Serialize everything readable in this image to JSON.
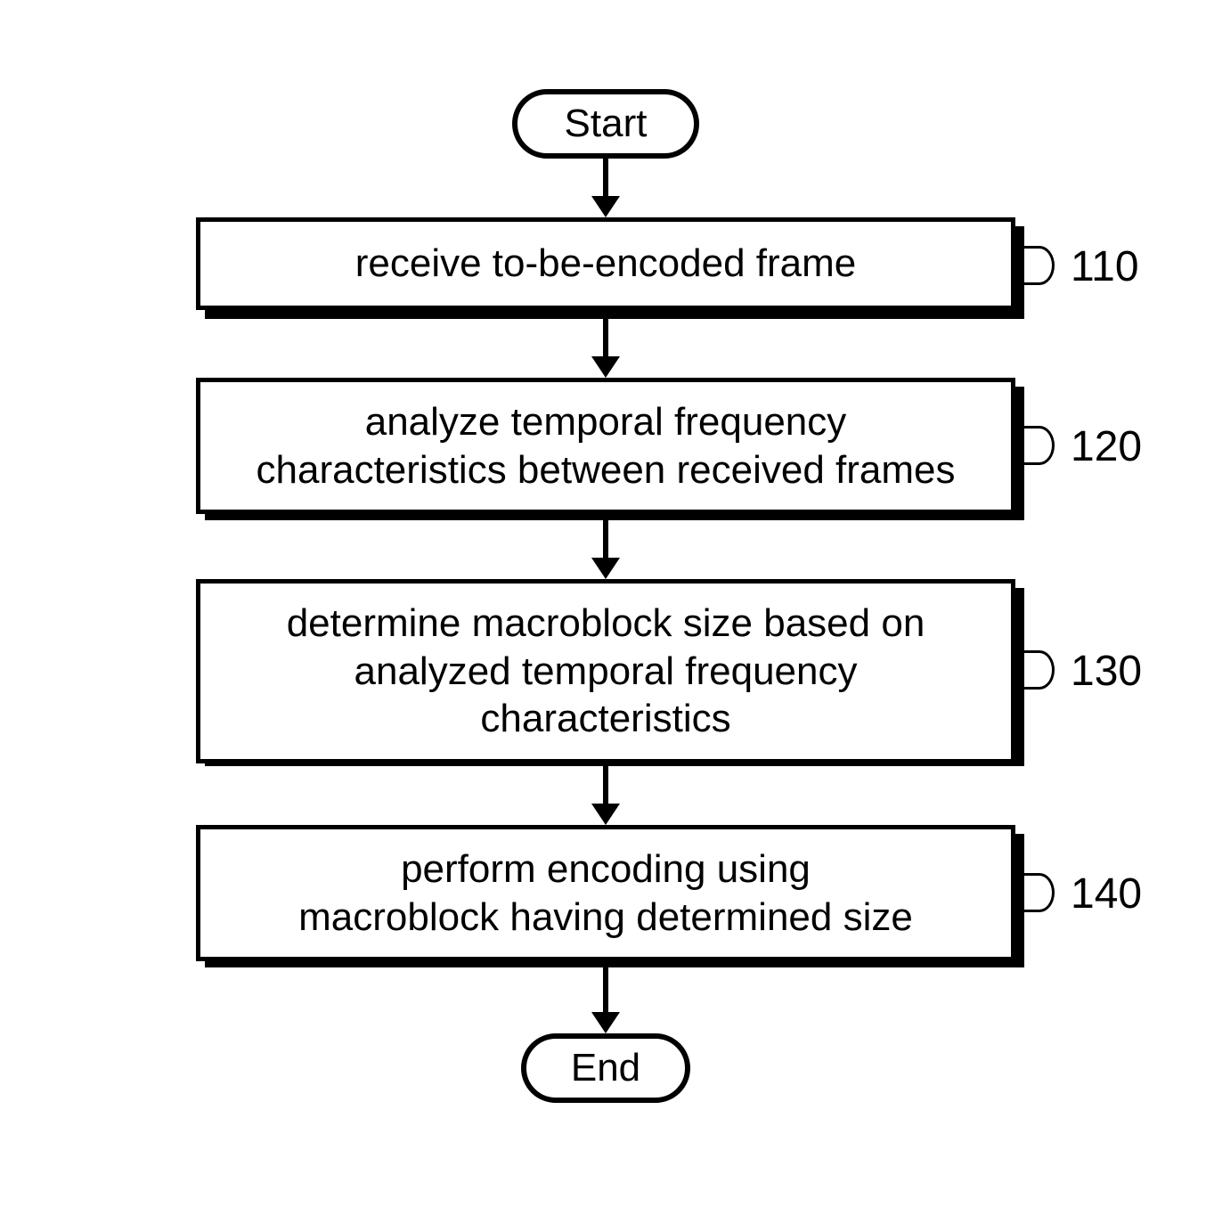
{
  "chart_data": {
    "type": "flowchart",
    "nodes": [
      {
        "id": "start",
        "type": "terminator",
        "label": "Start"
      },
      {
        "id": "110",
        "type": "process",
        "label": "receive to-be-encoded frame",
        "ref": "110"
      },
      {
        "id": "120",
        "type": "process",
        "label": "analyze temporal frequency\ncharacteristics between received frames",
        "ref": "120"
      },
      {
        "id": "130",
        "type": "process",
        "label": "determine macroblock size based on\nanalyzed temporal frequency\ncharacteristics",
        "ref": "130"
      },
      {
        "id": "140",
        "type": "process",
        "label": "perform encoding using\nmacroblock having determined size",
        "ref": "140"
      },
      {
        "id": "end",
        "type": "terminator",
        "label": "End"
      }
    ],
    "edges": [
      {
        "from": "start",
        "to": "110"
      },
      {
        "from": "110",
        "to": "120"
      },
      {
        "from": "120",
        "to": "130"
      },
      {
        "from": "130",
        "to": "140"
      },
      {
        "from": "140",
        "to": "end"
      }
    ]
  },
  "start": "Start",
  "end": "End",
  "steps": {
    "s110": {
      "text": "receive to-be-encoded frame",
      "ref": "110"
    },
    "s120": {
      "line1": "analyze temporal frequency",
      "line2": "characteristics between received frames",
      "ref": "120"
    },
    "s130": {
      "line1": "determine macroblock size based on",
      "line2": "analyzed temporal frequency",
      "line3": "characteristics",
      "ref": "130"
    },
    "s140": {
      "line1": "perform encoding using",
      "line2": "macroblock having determined size",
      "ref": "140"
    }
  }
}
